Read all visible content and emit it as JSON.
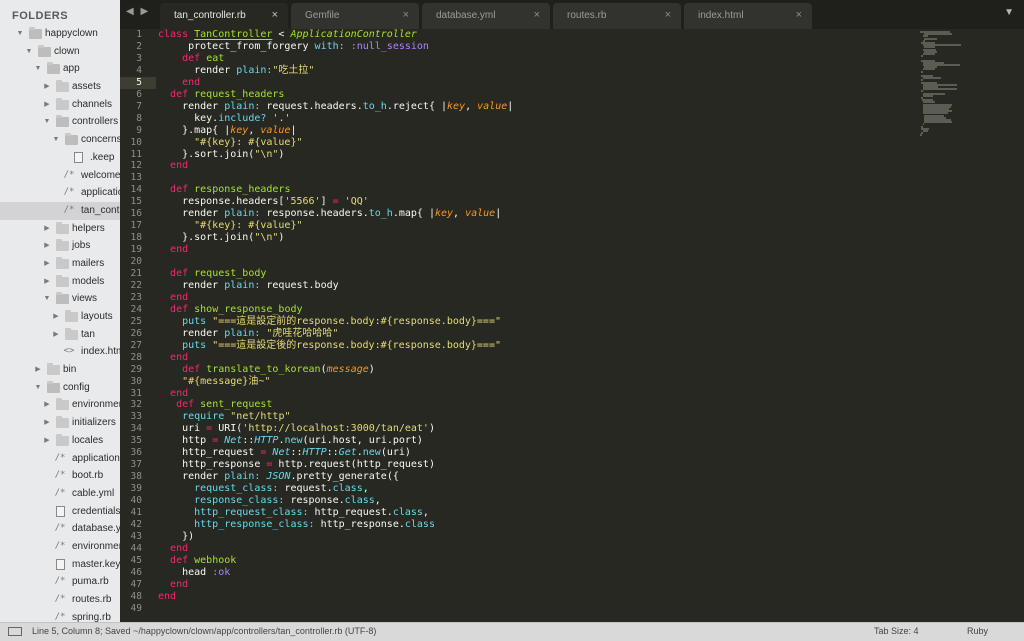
{
  "sidebar": {
    "header": "FOLDERS",
    "items": [
      {
        "label": "happyclown",
        "depth": 0,
        "kind": "folder",
        "open": true
      },
      {
        "label": "clown",
        "depth": 1,
        "kind": "folder",
        "open": true
      },
      {
        "label": "app",
        "depth": 2,
        "kind": "folder",
        "open": true
      },
      {
        "label": "assets",
        "depth": 3,
        "kind": "folder",
        "open": false
      },
      {
        "label": "channels",
        "depth": 3,
        "kind": "folder",
        "open": false
      },
      {
        "label": "controllers",
        "depth": 3,
        "kind": "folder",
        "open": true
      },
      {
        "label": "concerns",
        "depth": 4,
        "kind": "folder",
        "open": true
      },
      {
        "label": ".keep",
        "depth": 5,
        "kind": "doc"
      },
      {
        "label": "welcome",
        "depth": 4,
        "kind": "code"
      },
      {
        "label": "application",
        "depth": 4,
        "kind": "code"
      },
      {
        "label": "tan_contro",
        "depth": 4,
        "kind": "code",
        "selected": true
      },
      {
        "label": "helpers",
        "depth": 3,
        "kind": "folder",
        "open": false
      },
      {
        "label": "jobs",
        "depth": 3,
        "kind": "folder",
        "open": false
      },
      {
        "label": "mailers",
        "depth": 3,
        "kind": "folder",
        "open": false
      },
      {
        "label": "models",
        "depth": 3,
        "kind": "folder",
        "open": false
      },
      {
        "label": "views",
        "depth": 3,
        "kind": "folder",
        "open": true
      },
      {
        "label": "layouts",
        "depth": 4,
        "kind": "folder",
        "open": false
      },
      {
        "label": "tan",
        "depth": 4,
        "kind": "folder",
        "open": false
      },
      {
        "label": "index.htm",
        "depth": 4,
        "kind": "html"
      },
      {
        "label": "bin",
        "depth": 2,
        "kind": "folder",
        "open": false
      },
      {
        "label": "config",
        "depth": 2,
        "kind": "folder",
        "open": true
      },
      {
        "label": "environmen",
        "depth": 3,
        "kind": "folder",
        "open": false
      },
      {
        "label": "initializers",
        "depth": 3,
        "kind": "folder",
        "open": false
      },
      {
        "label": "locales",
        "depth": 3,
        "kind": "folder",
        "open": false
      },
      {
        "label": "application.",
        "depth": 3,
        "kind": "code"
      },
      {
        "label": "boot.rb",
        "depth": 3,
        "kind": "code"
      },
      {
        "label": "cable.yml",
        "depth": 3,
        "kind": "code"
      },
      {
        "label": "credentials.",
        "depth": 3,
        "kind": "doc"
      },
      {
        "label": "database.ym",
        "depth": 3,
        "kind": "code"
      },
      {
        "label": "environmen",
        "depth": 3,
        "kind": "code"
      },
      {
        "label": "master.key",
        "depth": 3,
        "kind": "doc"
      },
      {
        "label": "puma.rb",
        "depth": 3,
        "kind": "code"
      },
      {
        "label": "routes.rb",
        "depth": 3,
        "kind": "code"
      },
      {
        "label": "spring.rb",
        "depth": 3,
        "kind": "code"
      }
    ]
  },
  "tabs": [
    {
      "label": "tan_controller.rb",
      "active": true
    },
    {
      "label": "Gemfile",
      "active": false
    },
    {
      "label": "database.yml",
      "active": false
    },
    {
      "label": "routes.rb",
      "active": false
    },
    {
      "label": "index.html",
      "active": false
    }
  ],
  "tab_close_glyph": "×",
  "nav_arrows": "◀ ▶",
  "tab_menu_glyph": "▼",
  "editor": {
    "current_line": 5,
    "lines": [
      [
        [
          "kw",
          "class "
        ],
        [
          "type",
          "TanController"
        ],
        [
          "plain",
          " < "
        ],
        [
          "ital",
          "ApplicationController"
        ]
      ],
      [
        [
          "plain",
          "     protect_from_forgery "
        ],
        [
          "key",
          "with:"
        ],
        [
          "plain",
          " "
        ],
        [
          "sym",
          ":null_session"
        ]
      ],
      [
        [
          "plain",
          "    "
        ],
        [
          "kw",
          "def "
        ],
        [
          "func",
          "eat"
        ]
      ],
      [
        [
          "plain",
          "      render "
        ],
        [
          "key",
          "plain:"
        ],
        [
          "str",
          "\"吃土拉\""
        ]
      ],
      [
        [
          "plain",
          "    "
        ],
        [
          "kw",
          "end"
        ]
      ],
      [
        [
          "plain",
          "  "
        ],
        [
          "kw",
          "def "
        ],
        [
          "func",
          "request_headers"
        ]
      ],
      [
        [
          "plain",
          "    render "
        ],
        [
          "key",
          "plain:"
        ],
        [
          "plain",
          " request.headers."
        ],
        [
          "key",
          "to_h"
        ],
        [
          "plain",
          ".reject{ |"
        ],
        [
          "param",
          "key"
        ],
        [
          "plain",
          ", "
        ],
        [
          "param",
          "value"
        ],
        [
          "plain",
          "|"
        ]
      ],
      [
        [
          "plain",
          "      key."
        ],
        [
          "key",
          "include?"
        ],
        [
          "plain",
          " "
        ],
        [
          "str",
          "'.'"
        ]
      ],
      [
        [
          "plain",
          "    }.map{ |"
        ],
        [
          "param",
          "key"
        ],
        [
          "plain",
          ", "
        ],
        [
          "param",
          "value"
        ],
        [
          "plain",
          "|"
        ]
      ],
      [
        [
          "plain",
          "      "
        ],
        [
          "str",
          "\"#{key}: #{value}\""
        ]
      ],
      [
        [
          "plain",
          "    }.sort.join("
        ],
        [
          "str",
          "\"\\n\""
        ],
        [
          "plain",
          ")"
        ]
      ],
      [
        [
          "plain",
          "  "
        ],
        [
          "kw",
          "end"
        ]
      ],
      [
        [
          "plain",
          ""
        ]
      ],
      [
        [
          "plain",
          "  "
        ],
        [
          "kw",
          "def "
        ],
        [
          "func",
          "response_headers"
        ]
      ],
      [
        [
          "plain",
          "    response.headers["
        ],
        [
          "str",
          "'5566'"
        ],
        [
          "plain",
          "] "
        ],
        [
          "op",
          "="
        ],
        [
          "plain",
          " "
        ],
        [
          "str",
          "'QQ'"
        ]
      ],
      [
        [
          "plain",
          "    render "
        ],
        [
          "key",
          "plain:"
        ],
        [
          "plain",
          " response.headers."
        ],
        [
          "key",
          "to_h"
        ],
        [
          "plain",
          ".map{ |"
        ],
        [
          "param",
          "key"
        ],
        [
          "plain",
          ", "
        ],
        [
          "param",
          "value"
        ],
        [
          "plain",
          "|"
        ]
      ],
      [
        [
          "plain",
          "      "
        ],
        [
          "str",
          "\"#{key}: #{value}\""
        ]
      ],
      [
        [
          "plain",
          "    }.sort.join("
        ],
        [
          "str",
          "\"\\n\""
        ],
        [
          "plain",
          ")"
        ]
      ],
      [
        [
          "plain",
          "  "
        ],
        [
          "kw",
          "end"
        ]
      ],
      [
        [
          "plain",
          ""
        ]
      ],
      [
        [
          "plain",
          "  "
        ],
        [
          "kw",
          "def "
        ],
        [
          "func",
          "request_body"
        ]
      ],
      [
        [
          "plain",
          "    render "
        ],
        [
          "key",
          "plain:"
        ],
        [
          "plain",
          " request.body"
        ]
      ],
      [
        [
          "plain",
          "  "
        ],
        [
          "kw",
          "end"
        ]
      ],
      [
        [
          "plain",
          "  "
        ],
        [
          "kw",
          "def "
        ],
        [
          "func",
          "show_response_body"
        ]
      ],
      [
        [
          "plain",
          "    "
        ],
        [
          "key",
          "puts"
        ],
        [
          "plain",
          " "
        ],
        [
          "str",
          "\"===這是設定前的response.body:#{response.body}===\""
        ]
      ],
      [
        [
          "plain",
          "    render "
        ],
        [
          "key",
          "plain:"
        ],
        [
          "plain",
          " "
        ],
        [
          "str",
          "\"虎哇花哈哈哈\""
        ]
      ],
      [
        [
          "plain",
          "    "
        ],
        [
          "key",
          "puts"
        ],
        [
          "plain",
          " "
        ],
        [
          "str",
          "\"===這是設定後的response.body:#{response.body}===\""
        ]
      ],
      [
        [
          "plain",
          "  "
        ],
        [
          "kw",
          "end"
        ]
      ],
      [
        [
          "plain",
          "    "
        ],
        [
          "kw",
          "def "
        ],
        [
          "func",
          "translate_to_korean"
        ],
        [
          "plain",
          "("
        ],
        [
          "param",
          "message"
        ],
        [
          "plain",
          ")"
        ]
      ],
      [
        [
          "plain",
          "    "
        ],
        [
          "str",
          "\"#{message}油~\""
        ]
      ],
      [
        [
          "plain",
          "  "
        ],
        [
          "kw",
          "end"
        ]
      ],
      [
        [
          "plain",
          "   "
        ],
        [
          "kw",
          "def "
        ],
        [
          "func",
          "sent_request"
        ]
      ],
      [
        [
          "plain",
          "    "
        ],
        [
          "key",
          "require"
        ],
        [
          "plain",
          " "
        ],
        [
          "str",
          "\"net/http\""
        ]
      ],
      [
        [
          "plain",
          "    uri "
        ],
        [
          "op",
          "="
        ],
        [
          "plain",
          " URI("
        ],
        [
          "str",
          "'http://localhost:3000/tan/eat'"
        ],
        [
          "plain",
          ")"
        ]
      ],
      [
        [
          "plain",
          "    http "
        ],
        [
          "op",
          "="
        ],
        [
          "plain",
          " "
        ],
        [
          "const",
          "Net"
        ],
        [
          "plain",
          "::"
        ],
        [
          "const",
          "HTTP"
        ],
        [
          "plain",
          "."
        ],
        [
          "key",
          "new"
        ],
        [
          "plain",
          "(uri.host, uri.port)"
        ]
      ],
      [
        [
          "plain",
          "    http_request "
        ],
        [
          "op",
          "="
        ],
        [
          "plain",
          " "
        ],
        [
          "const",
          "Net"
        ],
        [
          "plain",
          "::"
        ],
        [
          "const",
          "HTTP"
        ],
        [
          "plain",
          "::"
        ],
        [
          "const",
          "Get"
        ],
        [
          "plain",
          "."
        ],
        [
          "key",
          "new"
        ],
        [
          "plain",
          "(uri)"
        ]
      ],
      [
        [
          "plain",
          "    http_response "
        ],
        [
          "op",
          "="
        ],
        [
          "plain",
          " http.request(http_request)"
        ]
      ],
      [
        [
          "plain",
          "    render "
        ],
        [
          "key",
          "plain:"
        ],
        [
          "plain",
          " "
        ],
        [
          "const",
          "JSON"
        ],
        [
          "plain",
          ".pretty_generate({"
        ]
      ],
      [
        [
          "plain",
          "      "
        ],
        [
          "key",
          "request_class:"
        ],
        [
          "plain",
          " request."
        ],
        [
          "key",
          "class"
        ],
        [
          "plain",
          ","
        ]
      ],
      [
        [
          "plain",
          "      "
        ],
        [
          "key",
          "response_class:"
        ],
        [
          "plain",
          " response."
        ],
        [
          "key",
          "class"
        ],
        [
          "plain",
          ","
        ]
      ],
      [
        [
          "plain",
          "      "
        ],
        [
          "key",
          "http_request_class:"
        ],
        [
          "plain",
          " http_request."
        ],
        [
          "key",
          "class"
        ],
        [
          "plain",
          ","
        ]
      ],
      [
        [
          "plain",
          "      "
        ],
        [
          "key",
          "http_response_class:"
        ],
        [
          "plain",
          " http_response."
        ],
        [
          "key",
          "class"
        ]
      ],
      [
        [
          "plain",
          "    })"
        ]
      ],
      [
        [
          "plain",
          "  "
        ],
        [
          "kw",
          "end"
        ]
      ],
      [
        [
          "plain",
          "  "
        ],
        [
          "kw",
          "def "
        ],
        [
          "func",
          "webhook"
        ]
      ],
      [
        [
          "plain",
          "    head "
        ],
        [
          "sym",
          ":ok"
        ]
      ],
      [
        [
          "plain",
          "  "
        ],
        [
          "kw",
          "end"
        ]
      ],
      [
        [
          "kw",
          "end"
        ]
      ],
      [
        [
          "plain",
          ""
        ]
      ]
    ]
  },
  "status": {
    "text": "Line 5, Column 8; Saved ~/happyclown/clown/app/controllers/tan_controller.rb (UTF-8)",
    "tab_size": "Tab Size: 4",
    "syntax": "Ruby"
  },
  "colors": {
    "editor_bg": "#272822",
    "sidebar_bg": "#e9eaec",
    "keyword": "#f92672",
    "function": "#a6e22e",
    "string": "#e6db74",
    "builtin": "#66d9ef",
    "symbol": "#ae81ff",
    "param": "#fd971f"
  }
}
